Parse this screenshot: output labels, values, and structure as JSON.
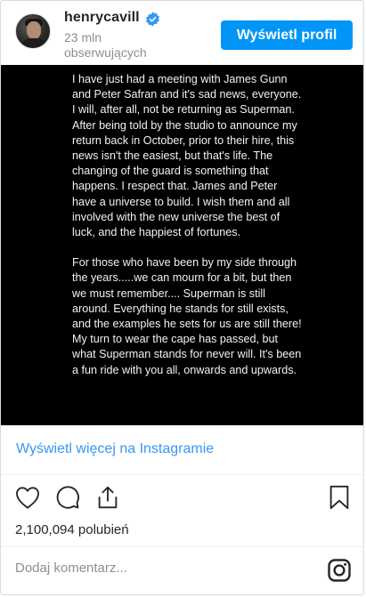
{
  "header": {
    "username": "henrycavill",
    "followers_count": "23 mln",
    "followers_label": "obserwujących",
    "view_profile_label": "Wyświetl profil"
  },
  "post": {
    "paragraphs": [
      "I have just had a meeting with James Gunn and Peter Safran and it's sad news, everyone. I will, after all, not be returning as Superman. After being told by the studio to announce my return back in October, prior to their hire, this news isn't the easiest, but that's life. The changing of the guard is something that happens. I respect that. James and Peter have a universe to build. I wish them and all involved with the new universe the best of luck, and the happiest of fortunes.",
      "For those who have been by my side through the years.....we can mourn for a bit, but then we must remember.... Superman is still around. Everything he stands for still exists, and the examples he sets for us are still there! My turn to wear the cape has passed, but what Superman stands for never will. It's been a fun ride with you all, onwards and upwards."
    ]
  },
  "view_more_label": "Wyświetl więcej na Instagramie",
  "likes_text": "2,100,094 polubień",
  "comment_placeholder": "Dodaj komentarz...",
  "icons": {
    "verified": "verified-badge-icon",
    "like": "heart-icon",
    "comment": "comment-bubble-icon",
    "share": "share-icon",
    "save": "bookmark-icon",
    "logo": "instagram-logo-icon"
  },
  "colors": {
    "accent": "#0095f6",
    "link": "#3897f0",
    "secondary_text": "#8e8e8e"
  }
}
